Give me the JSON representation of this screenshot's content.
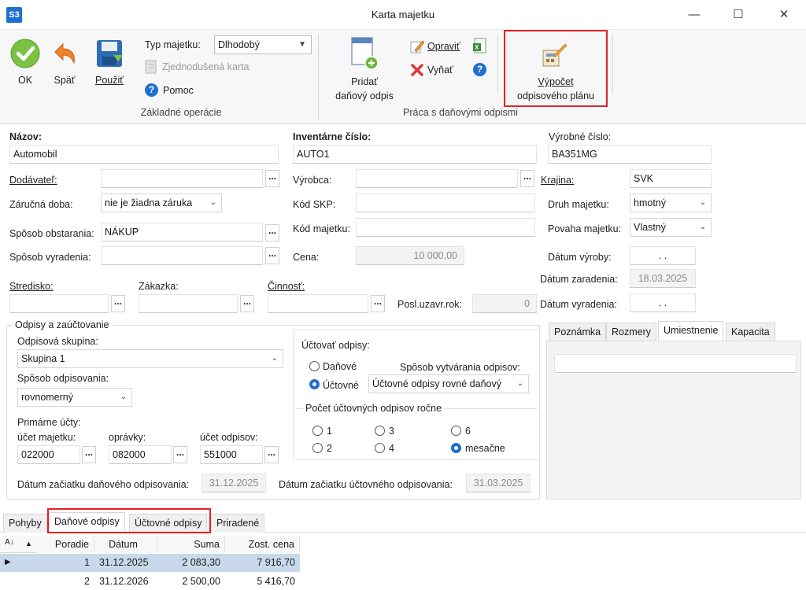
{
  "window": {
    "logo": "S3",
    "title": "Karta majetku",
    "controls": [
      "minimize-icon",
      "maximize-icon",
      "close-icon"
    ]
  },
  "ribbon": {
    "ok_label": "OK",
    "back_label": "Späť",
    "use_label": "Použiť",
    "asset_type_label": "Typ majetku:",
    "asset_type_value": "Dlhodobý",
    "simplified_card_label": "Zjednodušená karta",
    "help_label": "Pomoc",
    "group_basic": "Základné operácie",
    "add_tax_line1": "Pridať",
    "add_tax_line2": "daňový odpis",
    "edit_label": "Opraviť",
    "remove_label": "Vyňať",
    "group_tax": "Práca s daňovými odpismi",
    "calc_line1": "Výpočet",
    "calc_line2": "odpisového plánu"
  },
  "form": {
    "name_label": "Názov:",
    "name_value": "Automobil",
    "inv_label": "Inventárne číslo:",
    "inv_value": "AUTO1",
    "serial_label": "Výrobné číslo:",
    "serial_value": "BA351MG",
    "supplier_label": "Dodávateľ:",
    "supplier_value": "",
    "producer_label": "Výrobca:",
    "producer_value": "",
    "country_label": "Krajina:",
    "country_value": "SVK",
    "warranty_label": "Záručná doba:",
    "warranty_value": "nie je žiadna záruka",
    "skp_label": "Kód SKP:",
    "skp_value": "",
    "kind_label": "Druh majetku:",
    "kind_value": "hmotný",
    "acquire_label": "Spôsob obstarania:",
    "acquire_value": "NÁKUP",
    "asset_code_label": "Kód majetku:",
    "asset_code_value": "",
    "nature_label": "Povaha majetku:",
    "nature_value": "Vlastný",
    "disposal_label": "Spôsob vyradenia:",
    "disposal_value": "",
    "price_label": "Cena:",
    "price_value": "10 000,00",
    "prod_date_label": "Dátum výroby:",
    "prod_date_value": ".   .",
    "incl_date_label": "Dátum zaradenia:",
    "incl_date_value": "18.03.2025",
    "center_label": "Stredisko:",
    "order_label": "Zákazka:",
    "activity_label": "Činnosť:",
    "last_year_label": "Posl.uzavr.rok:",
    "last_year_value": "0",
    "disp_date_label": "Dátum vyradenia:",
    "disp_date_value": ".   ."
  },
  "depr": {
    "group_title": "Odpisy a zaúčtovanie",
    "group_label": "Odpisová skupina:",
    "group_value": "Skupina 1",
    "method_label": "Spôsob odpisovania:",
    "method_value": "rovnomerný",
    "primary_label": "Primárne účty:",
    "acc_asset_label": "účet majetku:",
    "acc_asset_value": "022000",
    "acc_corr_label": "oprávky:",
    "acc_corr_value": "082000",
    "acc_depr_label": "účet odpisov:",
    "acc_depr_value": "551000",
    "tax_start_label": "Dátum začiatku daňového odpisovania:",
    "tax_start_value": "31.12.2025",
    "acc_start_label": "Dátum začiatku účtovného odpisovania:",
    "acc_start_value": "31.03.2025",
    "post_label": "Účtovať odpisy:",
    "post_tax": "Daňové",
    "post_acc": "Účtovné",
    "creation_label": "Spôsob vytvárania odpisov:",
    "creation_value": "Účtovné odpisy rovné daňový",
    "count_label": "Počet účtovných odpisov ročne",
    "count_opts": [
      "1",
      "3",
      "6",
      "2",
      "4",
      "mesačne"
    ],
    "count_selected": "mesačne"
  },
  "right_tabs": [
    "Poznámka",
    "Rozmery",
    "Umiestnenie",
    "Kapacita"
  ],
  "bottom_tabs": [
    "Pohyby",
    "Daňové odpisy",
    "Účtovné odpisy",
    "Priradené"
  ],
  "grid": {
    "headers": [
      "Poradie",
      "Dátum",
      "Suma",
      "Zost. cena"
    ],
    "rows": [
      [
        "1",
        "31.12.2025",
        "2 083,30",
        "7 916,70"
      ],
      [
        "2",
        "31.12.2026",
        "2 500,00",
        "5 416,70"
      ]
    ]
  },
  "colors": {
    "highlight": "#e0202a",
    "accent": "#1f6fd0",
    "selected_row": "#c9d9ec"
  }
}
